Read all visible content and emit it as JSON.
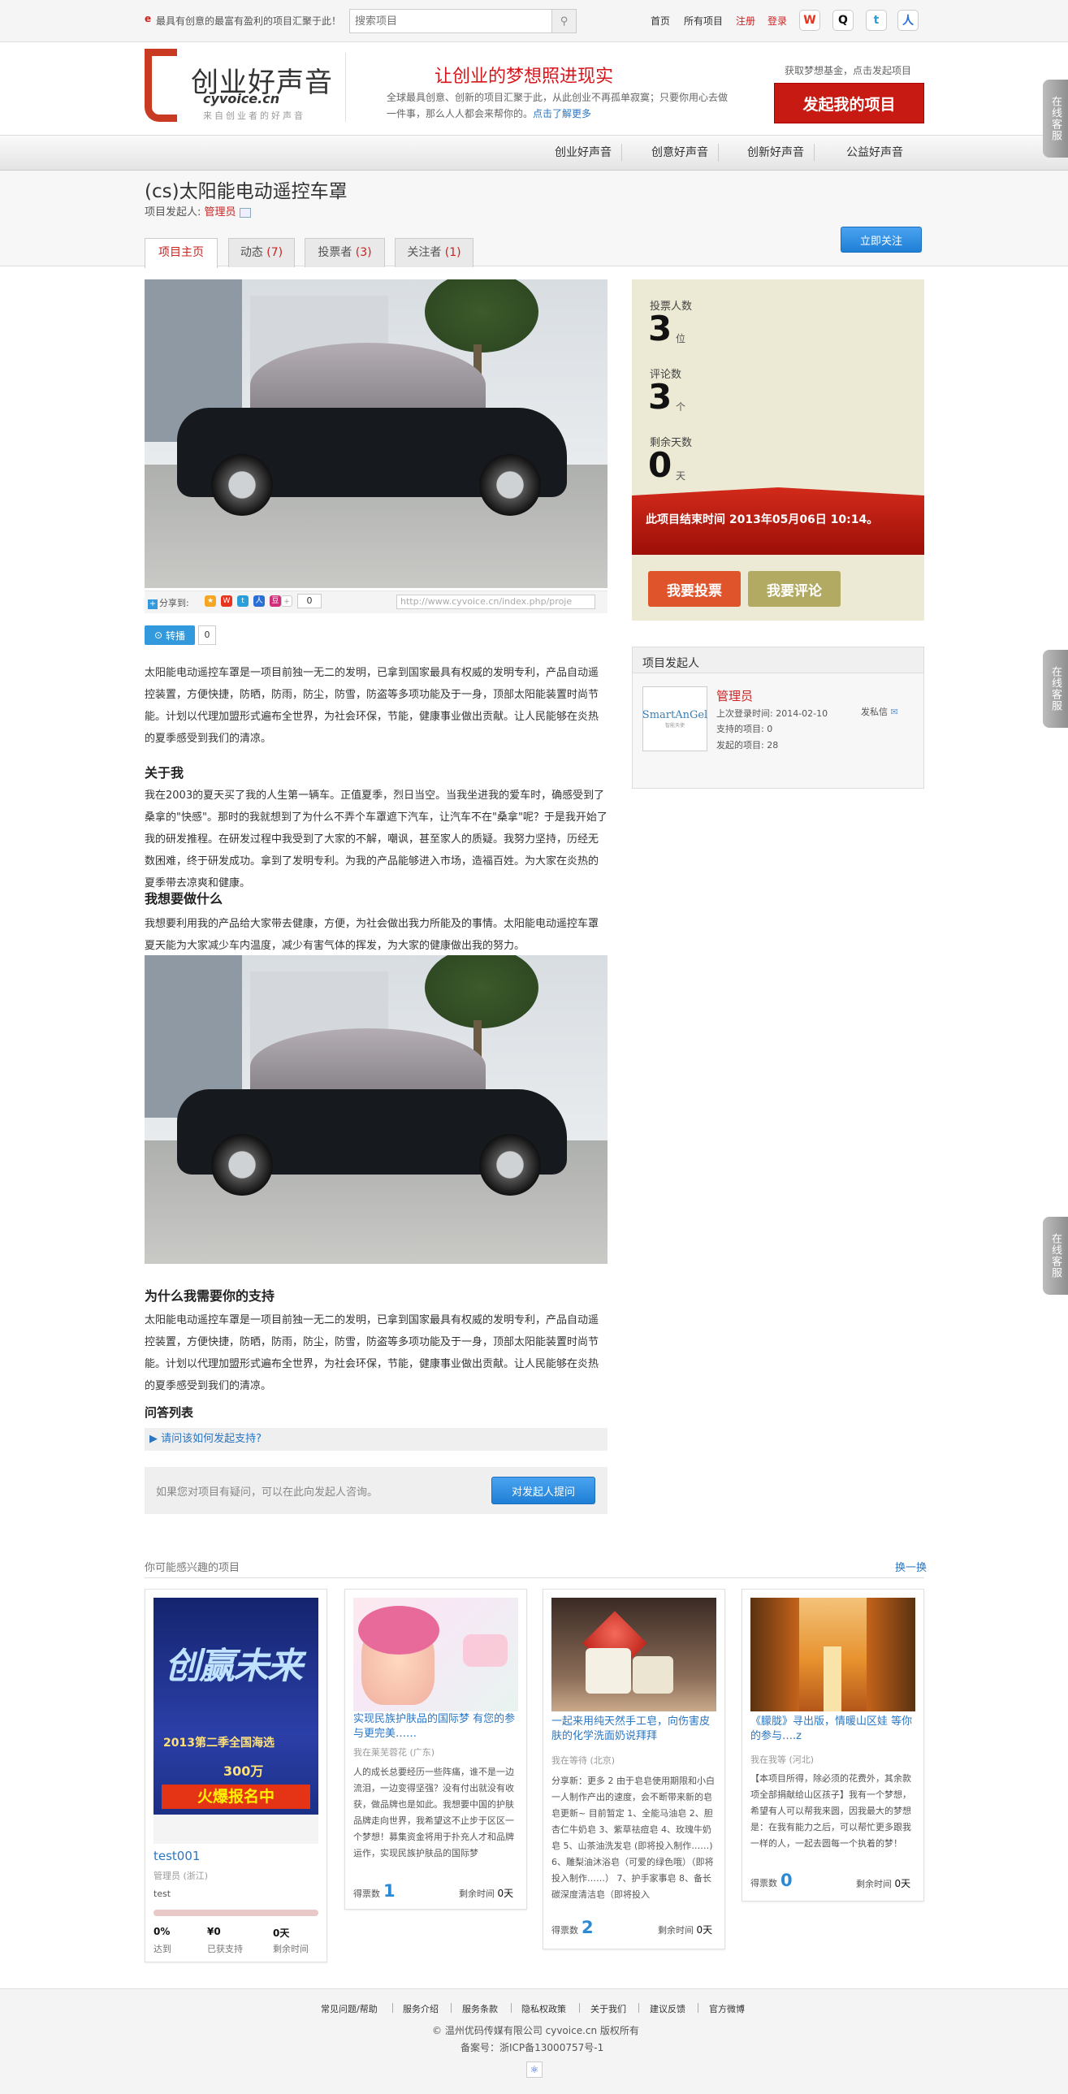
{
  "topbar": {
    "slogan": "最具有创意的最富有盈利的项目汇聚于此！",
    "search_placeholder": "搜索项目",
    "links": [
      "首页",
      "所有项目",
      "注册",
      "登录"
    ]
  },
  "header": {
    "logo_cn": "创业好声音",
    "logo_en": "cyvoice.cn",
    "logo_sub": "来自创业者的好声音",
    "headline": "让创业的梦想照进现实",
    "desc": "全球最具创意、创新的项目汇聚于此，从此创业不再孤单寂寞；只要你用心去做一件事，那么人人都会来帮你的。",
    "more_link": "点击了解更多",
    "fund_text": "获取梦想基金，点击发起项目",
    "launch_button": "发起我的项目"
  },
  "nav": {
    "items": [
      "创业好声音",
      "创意好声音",
      "创新好声音",
      "公益好声音"
    ]
  },
  "project": {
    "title": "(cs)太阳能电动遥控车罩",
    "owner_label": "项目发起人:",
    "owner_name": "管理员",
    "follow_button": "立即关注",
    "tabs": [
      {
        "label": "项目主页",
        "count": ""
      },
      {
        "label": "动态",
        "count": "(7)"
      },
      {
        "label": "投票者",
        "count": "(3)"
      },
      {
        "label": "关注者",
        "count": "(1)"
      }
    ]
  },
  "share": {
    "label": "分享到:",
    "count": "0",
    "url": "http://www.cyvoice.cn/index.php/proje",
    "repost_label": "转播",
    "repost_count": "0"
  },
  "content": {
    "intro": "太阳能电动遥控车罩是一项目前独一无二的发明，已拿到国家最具有权威的发明专利，产品自动遥控装置，方便快捷，防晒，防雨，防尘，防雪，防盗等多项功能及于一身，顶部太阳能装置时尚节能。计划以代理加盟形式遍布全世界，为社会环保，节能，健康事业做出贡献。让人民能够在炎热的夏季感受到我们的清凉。",
    "about_title": "关于我",
    "about": "我在2003的夏天买了我的人生第一辆车。正值夏季，烈日当空。当我坐进我的爱车时，确感受到了桑拿的\"快感\"。那时的我就想到了为什么不弄个车罩遮下汽车，让汽车不在\"桑拿\"呢？于是我开始了我的研发推程。在研发过程中我受到了大家的不解，嘲讽，甚至家人的质疑。我努力坚持，历经无数困难，终于研发成功。拿到了发明专利。为我的产品能够进入市场，造福百姓。为大家在炎热的夏季带去凉爽和健康。",
    "want_title": "我想要做什么",
    "want": "我想要利用我的产品给大家带去健康，方便，为社会做出我力所能及的事情。太阳能电动遥控车罩夏天能为大家减少车内温度，减少有害气体的挥发，为大家的健康做出我的努力。",
    "why_title": "为什么我需要你的支持",
    "why": "太阳能电动遥控车罩是一项目前独一无二的发明，已拿到国家最具有权威的发明专利，产品自动遥控装置，方便快捷，防晒，防雨，防尘，防雪，防盗等多项功能及于一身，顶部太阳能装置时尚节能。计划以代理加盟形式遍布全世界，为社会环保，节能，健康事业做出贡献。让人民能够在炎热的夏季感受到我们的清凉。",
    "qa_title": "问答列表",
    "qa_item": "▶ 请问该如何发起支持?",
    "ask_text": "如果您对项目有疑问，可以在此向发起人咨询。",
    "ask_button": "对发起人提问"
  },
  "stats": {
    "voters_label": "投票人数",
    "voters": "3",
    "voters_unit": "位",
    "comments_label": "评论数",
    "comments": "3",
    "comments_unit": "个",
    "days_label": "剩余天数",
    "days": "0",
    "days_unit": "天",
    "deadline": "此项目结束时间 2013年05月06日 10:14。",
    "vote_button": "我要投票",
    "comment_button": "我要评论"
  },
  "initiator": {
    "title": "项目发起人",
    "avatar_text": "SmartAnGel",
    "avatar_sub": "智能天使",
    "name": "管理员",
    "last_login": "上次登录时间: 2014-02-10",
    "pm": "发私信",
    "supported": "支持的项目: 0",
    "launched": "发起的项目: 28"
  },
  "recommend": {
    "title": "你可能感兴趣的项目",
    "refresh": "换一换",
    "cards": [
      {
        "title": "test001",
        "loc": "管理员 (浙江)",
        "desc": "test",
        "progress": 0,
        "pct": "0%",
        "pct_label": "达到",
        "amount": "¥0",
        "amount_label": "已获支持",
        "days": "0天",
        "days_label": "剩余时间",
        "poster_big": "创赢未来",
        "poster_mid": "2013第二季全国海选",
        "poster_prize": "300万",
        "poster_bottom": "火爆报名中"
      },
      {
        "title": "实现民族护肤品的国际梦 有您的参与更完美……",
        "loc": "我在莱芜蓉花 (广东)",
        "desc": "人的成长总要经历一些阵痛，谁不是一边流泪，一边变得坚强？没有付出就没有收获，做品牌也是如此。我想要中国的护肤品牌走向世界，我希望这不止步于区区一个梦想！募集资金将用于扑充人才和品牌运作，实现民族护肤品的国际梦",
        "votes": "1",
        "votes_label": "得票数",
        "days_label": "剩余时间",
        "days": "0天"
      },
      {
        "title": "一起来用纯天然手工皂，向伤害皮肤的化学洗面奶说拜拜",
        "loc": "我在等待 (北京)",
        "desc": "分享新：更多 2 由于皂皂使用期限和小白一人制作产出的速度，会不断带来新的皂皂更新~ 目前暂定 1、全能马油皂 2、胆杏仁牛奶皂 3、紫草祛痘皂 4、玫瑰牛奶皂 5、山茶油洗发皂 (即将投入制作……) 6、雕梨油沐浴皂（可爱的绿色哦）（即将投入制作……） 7、护手家事皂 8、备长碳深度清洁皂（即将投入",
        "votes": "2",
        "votes_label": "得票数",
        "days_label": "剩余时间",
        "days": "0天"
      },
      {
        "title": "《朦胧》寻出版，情暖山区娃 等你的参与….z",
        "loc": "我在我等 (河北)",
        "desc": "【本项目所得，除必须的花费外，其余款项全部捐献给山区孩子】我有一个梦想，希望有人可以帮我来圆，因我最大的梦想是：在我有能力之后，可以帮忙更多跟我一样的人，一起去圆每一个执着的梦！",
        "votes": "0",
        "votes_label": "得票数",
        "days_label": "剩余时间",
        "days": "0天"
      }
    ]
  },
  "footer": {
    "links": [
      "常见问题/帮助",
      "服务介绍",
      "服务条款",
      "隐私权政策",
      "关于我们",
      "建议反馈",
      "官方微博"
    ],
    "copyright": "© 温州优码传媒有限公司 cyvoice.cn 版权所有",
    "icp": "备案号：浙ICP备13000757号-1"
  },
  "service_tab": "在线客服"
}
